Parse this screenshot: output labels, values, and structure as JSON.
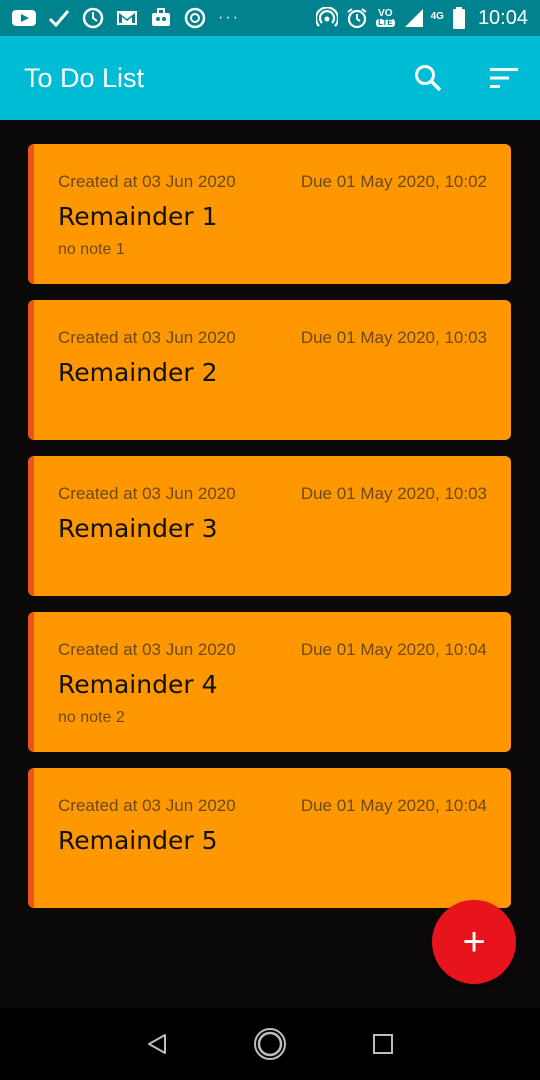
{
  "status_bar": {
    "time": "10:04",
    "network": "4G",
    "volte_top": "VO",
    "volte_bottom": "LTE",
    "more": "···",
    "icons": [
      "youtube-icon",
      "check-icon",
      "clock-icon",
      "gmail-icon",
      "toolbox-icon",
      "swirl-icon",
      "hotspot-icon",
      "alarm-icon",
      "volte-icon",
      "signal-icon",
      "battery-icon"
    ]
  },
  "app_bar": {
    "title": "To Do List",
    "actions": [
      "search-icon",
      "sort-icon"
    ]
  },
  "colors": {
    "status_bar": "#00838f",
    "app_bar": "#00bcd4",
    "background": "#0b0809",
    "card": "#ff9800",
    "card_stripe": "#ef5320",
    "fab": "#e8141c"
  },
  "tasks": [
    {
      "created": "Created at 03 Jun 2020",
      "due": "Due 01 May 2020, 10:02",
      "title": "Remainder 1",
      "note": "no note 1"
    },
    {
      "created": "Created at 03 Jun 2020",
      "due": "Due 01 May 2020, 10:03",
      "title": "Remainder 2",
      "note": ""
    },
    {
      "created": "Created at 03 Jun 2020",
      "due": "Due 01 May 2020, 10:03",
      "title": "Remainder 3",
      "note": ""
    },
    {
      "created": "Created at 03 Jun 2020",
      "due": "Due 01 May 2020, 10:04",
      "title": "Remainder 4",
      "note": "no note 2"
    },
    {
      "created": "Created at 03 Jun 2020",
      "due": "Due 01 May 2020, 10:04",
      "title": "Remainder 5",
      "note": ""
    }
  ],
  "fab": {
    "label": "+",
    "icon": "plus-icon"
  },
  "nav_bar": {
    "buttons": [
      "back-icon",
      "home-icon",
      "recents-icon"
    ]
  }
}
